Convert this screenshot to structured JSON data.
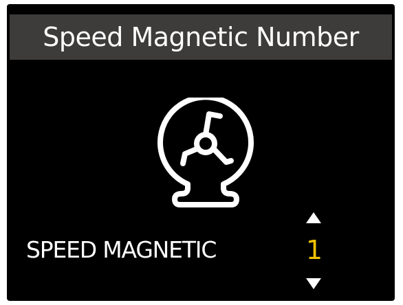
{
  "header": {
    "title": "Speed Magnetic Number"
  },
  "main": {
    "icon": "magnetic-sensor-icon",
    "setting": {
      "label": "SPEED MAGNETIC",
      "value": "1",
      "increase_icon": "triangle-up-icon",
      "decrease_icon": "triangle-down-icon"
    }
  },
  "colors": {
    "background": "#000000",
    "title_bar": "#3d3c3b",
    "text": "#ffffff",
    "value": "#f2c200"
  }
}
